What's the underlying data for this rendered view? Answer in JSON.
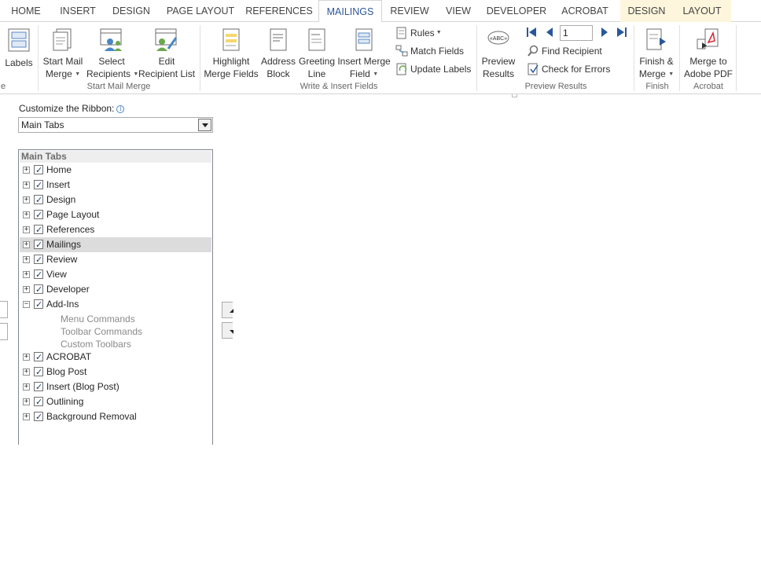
{
  "tabs": [
    {
      "label": "HOME"
    },
    {
      "label": "INSERT"
    },
    {
      "label": "DESIGN"
    },
    {
      "label": "PAGE LAYOUT"
    },
    {
      "label": "REFERENCES"
    },
    {
      "label": "MAILINGS"
    },
    {
      "label": "REVIEW"
    },
    {
      "label": "VIEW"
    },
    {
      "label": "DEVELOPER"
    },
    {
      "label": "ACROBAT"
    },
    {
      "label": "DESIGN"
    },
    {
      "label": "LAYOUT"
    }
  ],
  "active_tab": "MAILINGS",
  "ribbon": {
    "groups": {
      "start_mail_merge": "Start Mail Merge",
      "write_insert": "Write & Insert Fields",
      "preview_results": "Preview Results",
      "finish": "Finish",
      "acrobat": "Acrobat",
      "cut_group_tail": "e"
    },
    "labels_btn": "Labels",
    "start_mail_merge_btn": {
      "line1": "Start Mail",
      "line2": "Merge"
    },
    "select_recipients_btn": {
      "line1": "Select",
      "line2": "Recipients"
    },
    "edit_recipient_btn": {
      "line1": "Edit",
      "line2": "Recipient List"
    },
    "highlight_btn": {
      "line1": "Highlight",
      "line2": "Merge Fields"
    },
    "address_block_btn": {
      "line1": "Address",
      "line2": "Block"
    },
    "greeting_line_btn": {
      "line1": "Greeting",
      "line2": "Line"
    },
    "insert_merge_btn": {
      "line1": "Insert Merge",
      "line2": "Field"
    },
    "rules_btn": "Rules",
    "match_fields_btn": "Match Fields",
    "update_labels_btn": "Update Labels",
    "preview_btn": {
      "line1": "Preview",
      "line2": "Results"
    },
    "record_value": "1",
    "find_recipient_btn": "Find Recipient",
    "check_errors_btn": "Check for Errors",
    "finish_merge_btn": {
      "line1": "Finish &",
      "line2": "Merge"
    },
    "merge_pdf_btn": {
      "line1": "Merge to",
      "line2": "Adobe PDF"
    }
  },
  "customize": {
    "label": "Customize the Ribbon:",
    "dropdown_value": "Main Tabs",
    "tree_header": "Main Tabs",
    "items": [
      {
        "label": "Home",
        "expander": "+",
        "checked": true
      },
      {
        "label": "Insert",
        "expander": "+",
        "checked": true
      },
      {
        "label": "Design",
        "expander": "+",
        "checked": true
      },
      {
        "label": "Page Layout",
        "expander": "+",
        "checked": true
      },
      {
        "label": "References",
        "expander": "+",
        "checked": true
      },
      {
        "label": "Mailings",
        "expander": "+",
        "checked": true,
        "selected": true
      },
      {
        "label": "Review",
        "expander": "+",
        "checked": true
      },
      {
        "label": "View",
        "expander": "+",
        "checked": true
      },
      {
        "label": "Developer",
        "expander": "+",
        "checked": true
      },
      {
        "label": "Add-Ins",
        "expander": "−",
        "checked": true
      }
    ],
    "addins_children": [
      "Menu Commands",
      "Toolbar Commands",
      "Custom Toolbars"
    ],
    "items_after": [
      {
        "label": "ACROBAT",
        "expander": "+",
        "checked": true
      },
      {
        "label": "Blog Post",
        "expander": "+",
        "checked": true
      },
      {
        "label": "Insert (Blog Post)",
        "expander": "+",
        "checked": true
      },
      {
        "label": "Outlining",
        "expander": "+",
        "checked": true
      },
      {
        "label": "Background Removal",
        "expander": "+",
        "checked": true
      }
    ]
  },
  "colors": {
    "accent": "#2b579a",
    "context_tab_bg": "#fdf6dc",
    "selected_row": "#dcdcdc"
  }
}
